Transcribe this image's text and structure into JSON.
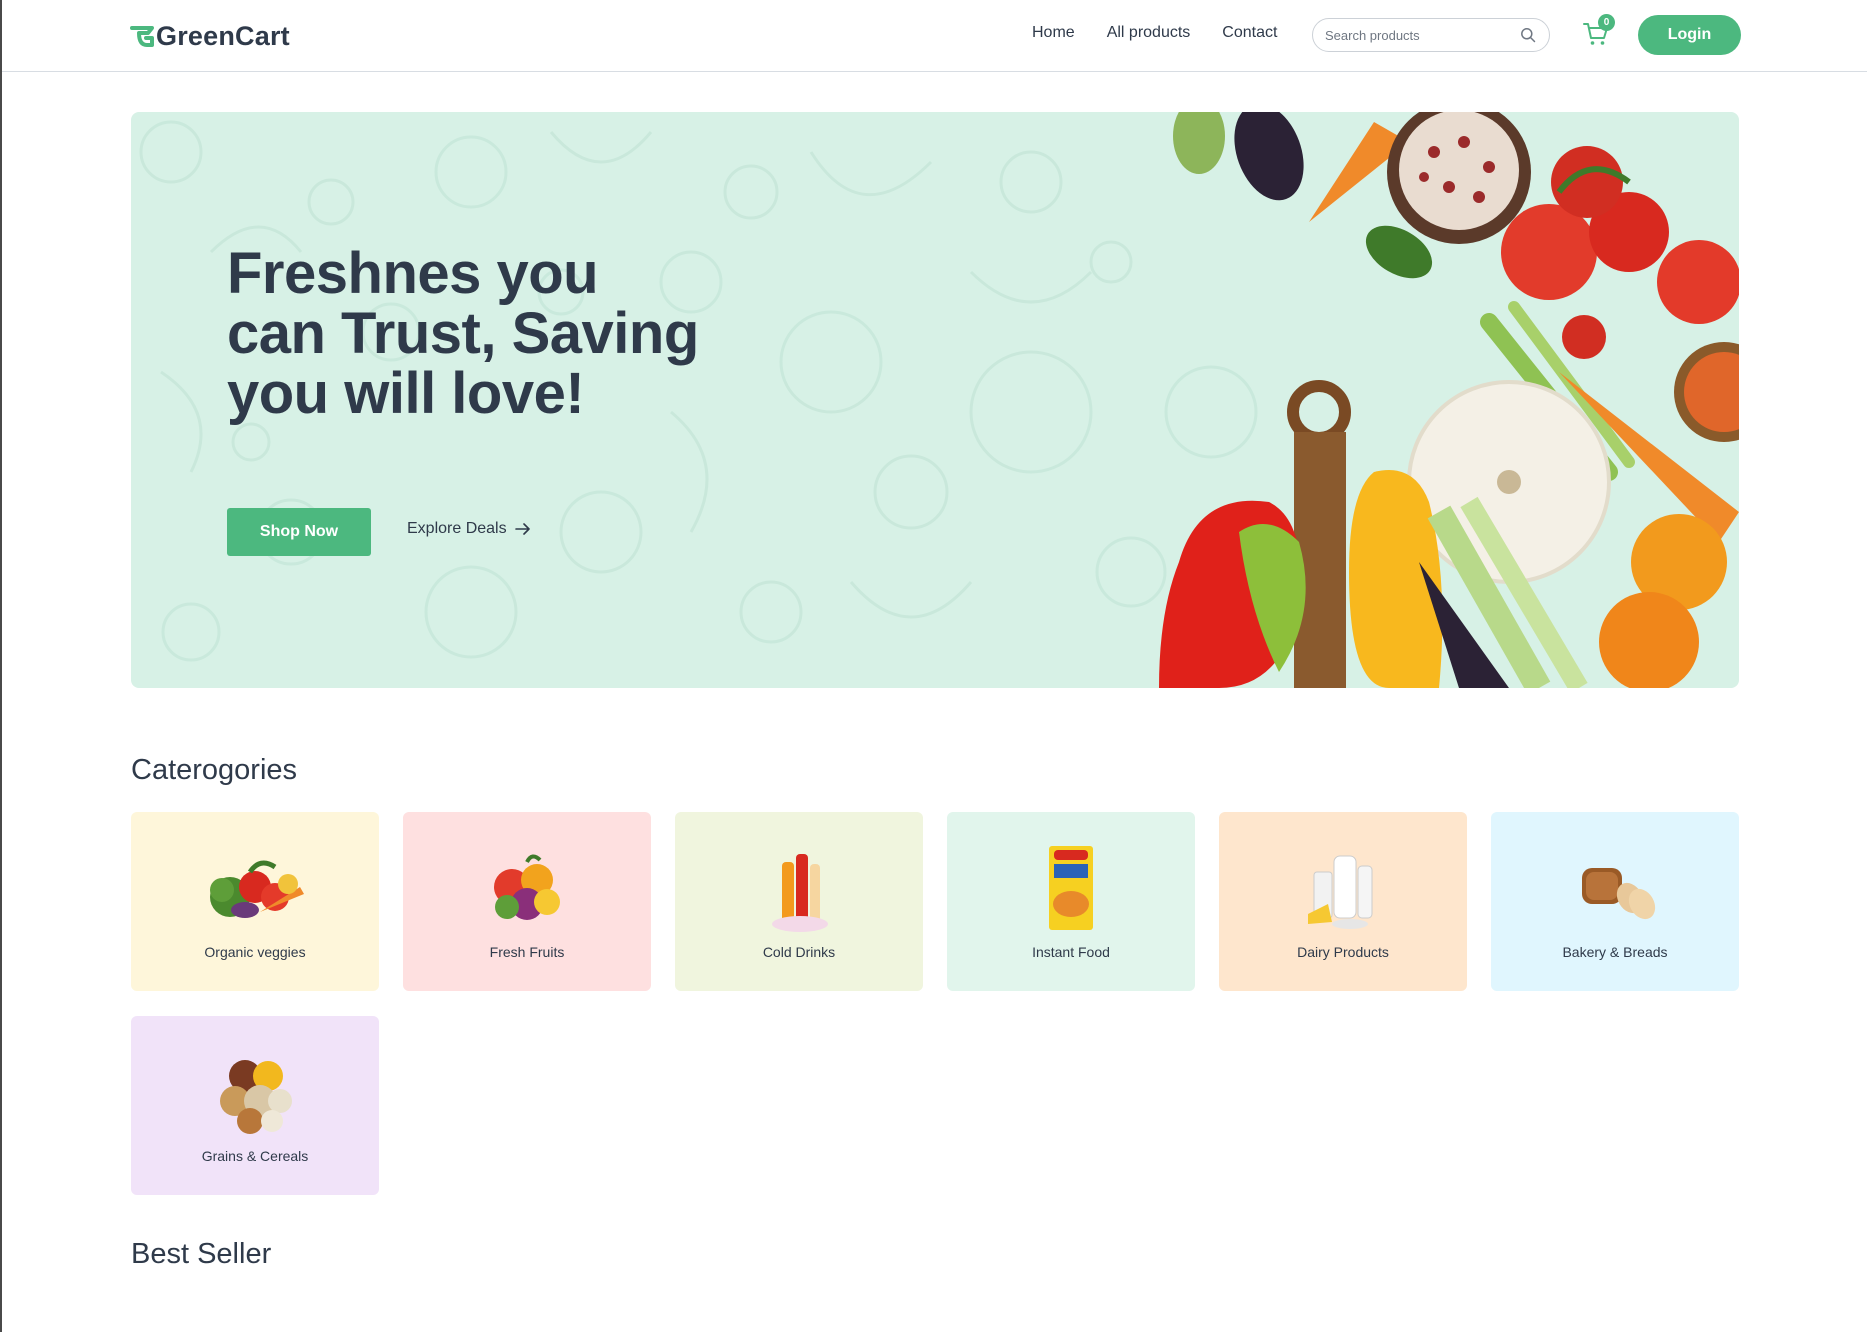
{
  "header": {
    "brand": "GreenCart",
    "nav": [
      "Home",
      "All products",
      "Contact"
    ],
    "search_placeholder": "Search products",
    "cart_count": "0",
    "login_label": "Login"
  },
  "hero": {
    "title": "Freshnes you can Trust, Saving you will love!",
    "primary_cta": "Shop Now",
    "secondary_cta": "Explore Deals"
  },
  "categories": {
    "title": "Caterogories",
    "items": [
      {
        "label": "Organic veggies",
        "bg": "#fef6da"
      },
      {
        "label": "Fresh Fruits",
        "bg": "#fee0e0"
      },
      {
        "label": "Cold Drinks",
        "bg": "#f0f5de"
      },
      {
        "label": "Instant Food",
        "bg": "#e1f5ec"
      },
      {
        "label": "Dairy Products",
        "bg": "#fee6cd"
      },
      {
        "label": "Bakery & Breads",
        "bg": "#e0f6fe"
      },
      {
        "label": "Grains & Cereals",
        "bg": "#f1e3f9"
      }
    ]
  },
  "best_seller": {
    "title": "Best Seller"
  },
  "colors": {
    "accent": "#4cb87f",
    "hero_bg": "#d7f1e6",
    "text": "#2f3a4a"
  }
}
